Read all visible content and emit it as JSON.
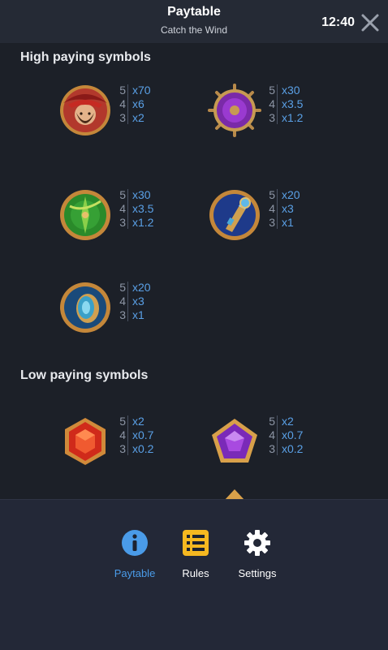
{
  "header": {
    "title": "Paytable",
    "subtitle": "Catch the Wind",
    "clock": "12:40"
  },
  "sections": {
    "high_title": "High paying symbols",
    "low_title": "Low paying symbols"
  },
  "high_symbols": [
    {
      "icon": "pirate-captain-icon",
      "pays": [
        {
          "count": "5",
          "mult": "x70"
        },
        {
          "count": "4",
          "mult": "x6"
        },
        {
          "count": "3",
          "mult": "x2"
        }
      ]
    },
    {
      "icon": "ship-wheel-icon",
      "pays": [
        {
          "count": "5",
          "mult": "x30"
        },
        {
          "count": "4",
          "mult": "x3.5"
        },
        {
          "count": "3",
          "mult": "x1.2"
        }
      ]
    },
    {
      "icon": "compass-green-icon",
      "pays": [
        {
          "count": "5",
          "mult": "x30"
        },
        {
          "count": "4",
          "mult": "x3.5"
        },
        {
          "count": "3",
          "mult": "x1.2"
        }
      ]
    },
    {
      "icon": "spyglass-icon",
      "pays": [
        {
          "count": "5",
          "mult": "x20"
        },
        {
          "count": "4",
          "mult": "x3"
        },
        {
          "count": "3",
          "mult": "x1"
        }
      ]
    },
    {
      "icon": "pocket-compass-icon",
      "pays": [
        {
          "count": "5",
          "mult": "x20"
        },
        {
          "count": "4",
          "mult": "x3"
        },
        {
          "count": "3",
          "mult": "x1"
        }
      ]
    }
  ],
  "low_symbols": [
    {
      "icon": "red-hexagon-gem-icon",
      "pays": [
        {
          "count": "5",
          "mult": "x2"
        },
        {
          "count": "4",
          "mult": "x0.7"
        },
        {
          "count": "3",
          "mult": "x0.2"
        }
      ]
    },
    {
      "icon": "purple-pentagon-gem-icon",
      "pays": [
        {
          "count": "5",
          "mult": "x2"
        },
        {
          "count": "4",
          "mult": "x0.7"
        },
        {
          "count": "3",
          "mult": "x0.2"
        }
      ]
    }
  ],
  "nav": {
    "paytable": "Paytable",
    "rules": "Rules",
    "settings": "Settings"
  },
  "colors": {
    "background": "#1c2028",
    "multiplier": "#5aa0e6",
    "active_nav": "#4a9be8",
    "rules_icon": "#f5b820"
  }
}
